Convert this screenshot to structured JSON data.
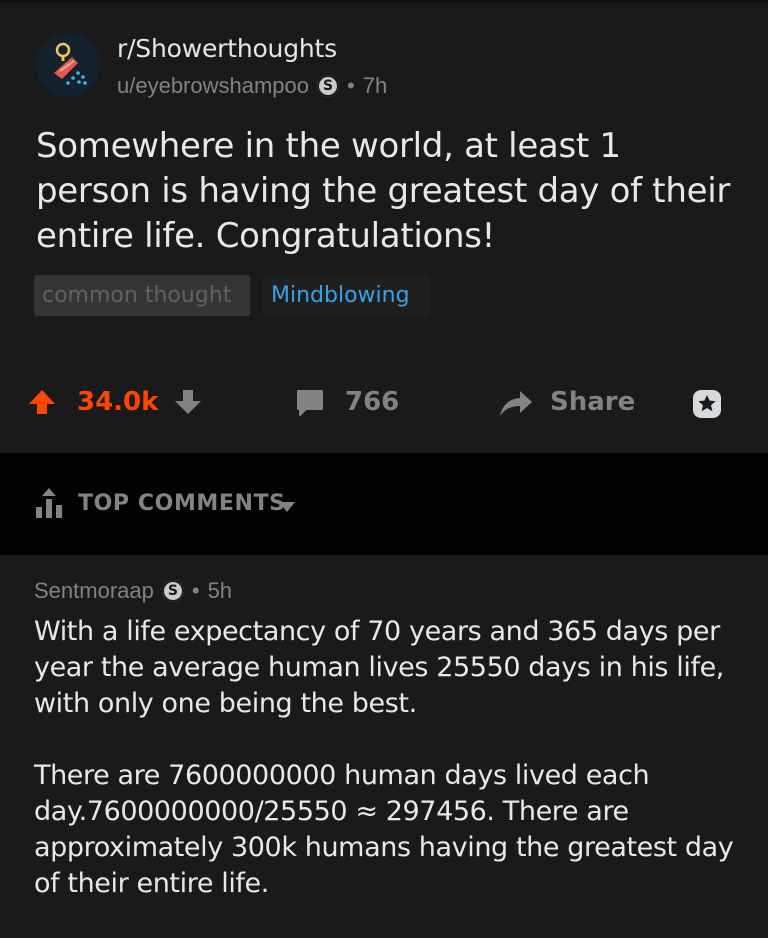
{
  "post": {
    "subreddit": "r/Showerthoughts",
    "author": "u/eyebrowshampoo",
    "award_glyph": "S",
    "separator": "•",
    "time": "7h",
    "title": "Somewhere in the world, at least 1 person is having the greatest day of their entire life. Congratulations!",
    "flairs": [
      {
        "label": "common thought",
        "color": "#5f6163",
        "bg": "#343536"
      },
      {
        "label": "Mindblowing",
        "color": "#3aa0e6",
        "bg": "#1f1f20"
      }
    ]
  },
  "actions": {
    "upvote_icon": "arrow-up-icon",
    "score": "34.0k",
    "downvote_icon": "arrow-down-icon",
    "comments_count": "766",
    "share_label": "Share",
    "award_icon": "award-icon",
    "accent_color": "#ff4500"
  },
  "sort": {
    "label": "TOP COMMENTS",
    "icon": "sort-top-icon"
  },
  "comment": {
    "author": "Sentmoraap",
    "award_glyph": "S",
    "separator": "•",
    "time": "5h",
    "paragraphs": [
      "With a life expectancy of 70 years and 365 days per year the average human lives 25550 days in his life, with only one being the best.",
      "There are 7600000000 human days lived each day.7600000000/25550 ≈ 297456. There are approximately 300k humans having the greatest day of their entire life."
    ]
  }
}
